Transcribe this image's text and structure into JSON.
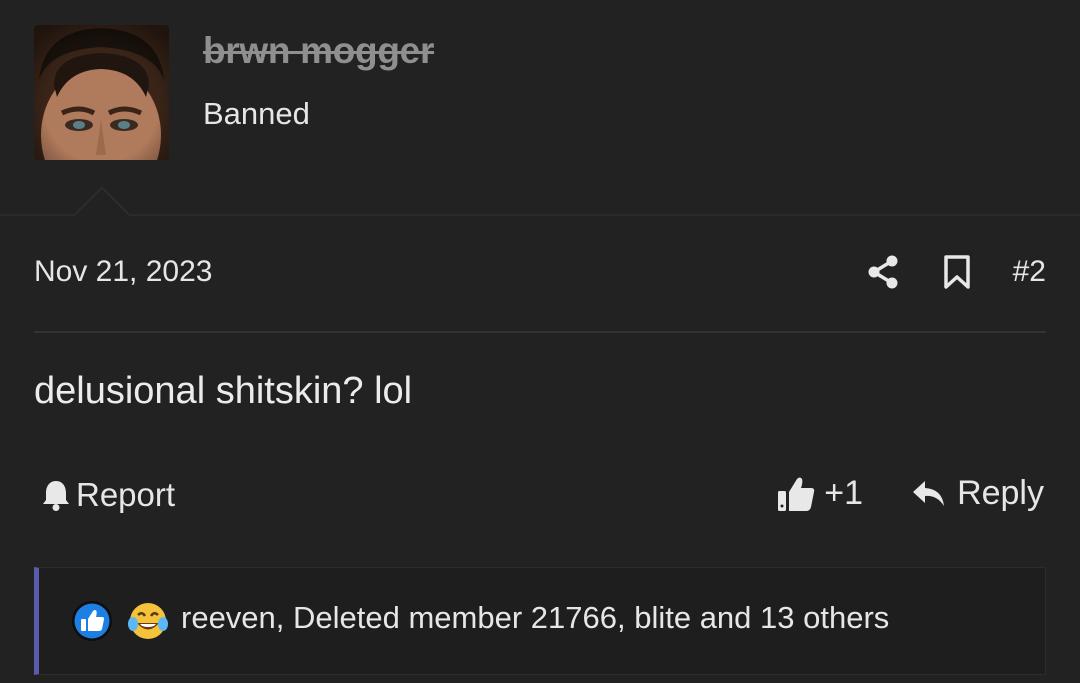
{
  "user": {
    "username": "brwn mogger",
    "title": "Banned"
  },
  "post": {
    "date": "Nov 21, 2023",
    "number": "#2",
    "body": "delusional shitskin? lol"
  },
  "actions": {
    "report_label": "Report",
    "like_label": "+1",
    "reply_label": "Reply"
  },
  "reactions": {
    "summary": "reeven, Deleted member 21766, blite and 13 others",
    "icons": [
      "like-reaction-icon",
      "laughing-crying-reaction-icon"
    ]
  },
  "colors": {
    "background": "#222222",
    "accent": "#5a5dad",
    "like_blue": "#1d7fe3",
    "username_muted": "#8f8f8f"
  }
}
